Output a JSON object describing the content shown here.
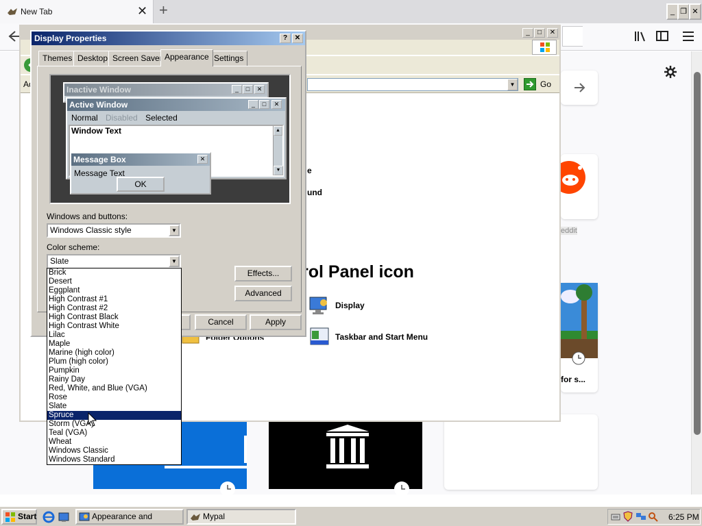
{
  "browser": {
    "tab_title": "New Tab",
    "tab_close": "✕",
    "new_tab": "+",
    "window_buttons": {
      "minimize": "_",
      "restore": "❐",
      "close": "✕"
    }
  },
  "control_panel": {
    "address_go": "Go",
    "heading": "rol Panel icon",
    "frag_e": "e",
    "frag_und": "und",
    "display_label": "Display",
    "taskbar_label": "Taskbar and Start Menu",
    "folder_label": "Folder Options"
  },
  "newtab": {
    "reddit_label": "eddit",
    "tile_label": "for s..."
  },
  "dialog": {
    "title": "Display Properties",
    "help": "?",
    "close": "✕",
    "tabs": [
      "Themes",
      "Desktop",
      "Screen Saver",
      "Appearance",
      "Settings"
    ],
    "active_tab": "Appearance",
    "preview": {
      "inactive_title": "Inactive Window",
      "active_title": "Active Window",
      "menu_normal": "Normal",
      "menu_disabled": "Disabled",
      "menu_selected": "Selected",
      "window_text": "Window Text",
      "msgbox_title": "Message Box",
      "msgbox_text": "Message Text",
      "ok": "OK"
    },
    "windows_buttons_label": "Windows and buttons:",
    "windows_buttons_value": "Windows Classic style",
    "color_scheme_label": "Color scheme:",
    "color_scheme_value": "Slate",
    "effects_button": "Effects...",
    "advanced_button": "Advanced",
    "cancel_button": "Cancel",
    "apply_button": "Apply",
    "color_scheme_options": [
      "Brick",
      "Desert",
      "Eggplant",
      "High Contrast #1",
      "High Contrast #2",
      "High Contrast Black",
      "High Contrast White",
      "Lilac",
      "Maple",
      "Marine (high color)",
      "Plum (high color)",
      "Pumpkin",
      "Rainy Day",
      "Red, White, and Blue (VGA)",
      "Rose",
      "Slate",
      "Spruce",
      "Storm (VGA)",
      "Teal (VGA)",
      "Wheat",
      "Windows Classic",
      "Windows Standard"
    ],
    "highlighted_option": "Spruce"
  },
  "taskbar": {
    "start": "Start",
    "item1": "Appearance and Themes",
    "item2": "Mypal",
    "clock": "6:25 PM"
  },
  "colors": {
    "titlebar": "#0a246a",
    "highlight": "#0a246a",
    "face": "#d4d0c8",
    "preview_dark": "#3c3c3c"
  }
}
